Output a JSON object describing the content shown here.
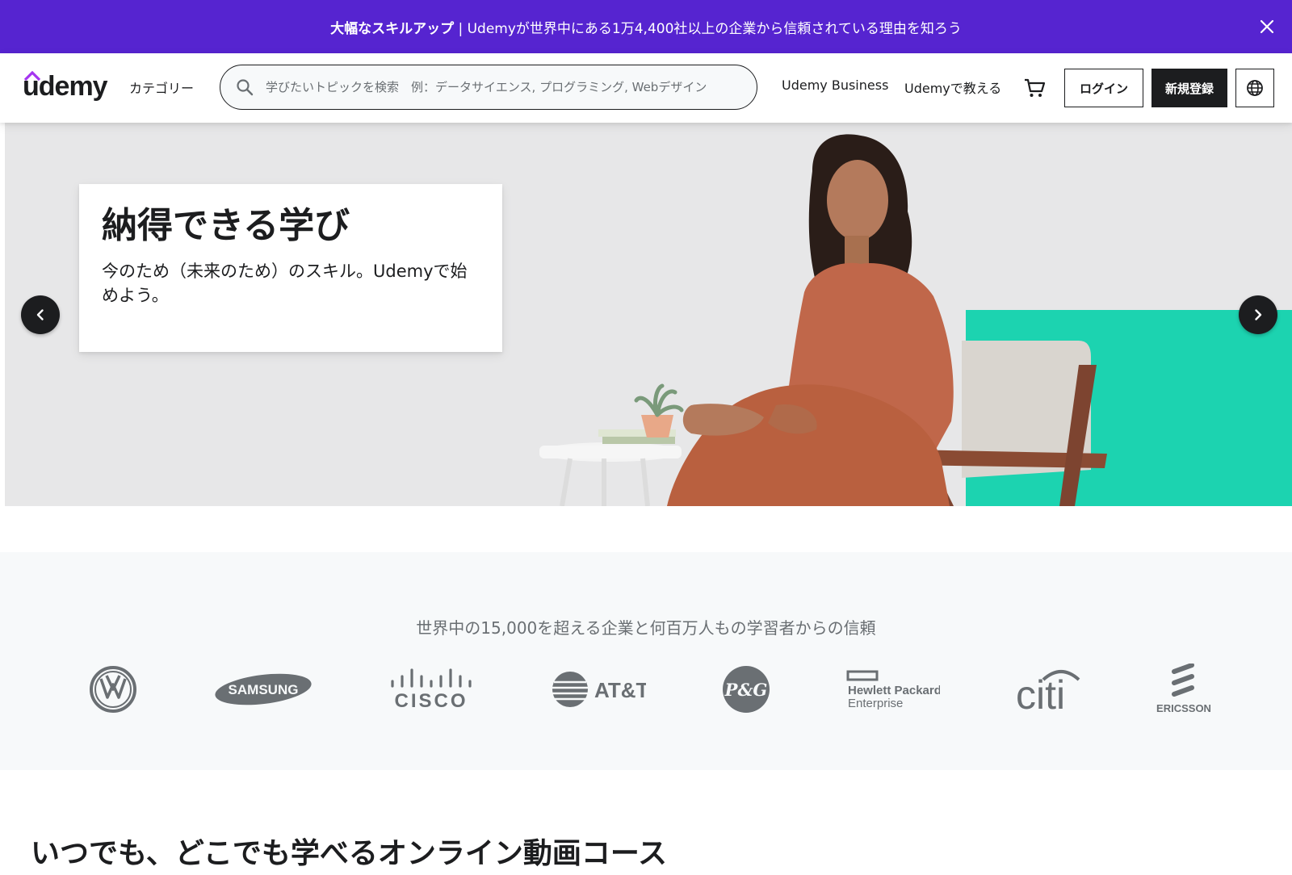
{
  "banner": {
    "bold": "大幅なスキルアップ",
    "text": " | Udemyが世界中にある1万4,400社以上の企業から信頼されている理由を知ろう",
    "bg_color": "#5624d0"
  },
  "header": {
    "logo": "udemy",
    "categories": "カテゴリー",
    "search_placeholder": "学びたいトピックを検索　例：データサイエンス, プログラミング, Webデザイン",
    "business": "Udemy Business",
    "teach": "Udemyで教える",
    "cart_icon": "cart-icon",
    "login": "ログイン",
    "signup": "新規登録",
    "language_icon": "globe-icon"
  },
  "hero": {
    "title": "納得できる学び",
    "subtitle": "今のため（未来のため）のスキル。Udemyで始めよう。",
    "accent_color": "#1cd3b0",
    "prev_icon": "chevron-left-icon",
    "next_icon": "chevron-right-icon"
  },
  "trusted": {
    "title": "世界中の15,000を超える企業と何百万人もの学習者からの信頼",
    "logos": [
      {
        "name": "volkswagen",
        "text": "VW"
      },
      {
        "name": "samsung",
        "text": "SAMSUNG"
      },
      {
        "name": "cisco",
        "text": "CISCO"
      },
      {
        "name": "att",
        "text": "AT&T"
      },
      {
        "name": "pg",
        "text": "P&G"
      },
      {
        "name": "hpe",
        "line1": "Hewlett Packard",
        "line2": "Enterprise"
      },
      {
        "name": "citi",
        "text": "citi"
      },
      {
        "name": "ericsson",
        "text": "ERICSSON"
      }
    ]
  },
  "section": {
    "title": "いつでも、どこでも学べるオンライン動画コース"
  }
}
